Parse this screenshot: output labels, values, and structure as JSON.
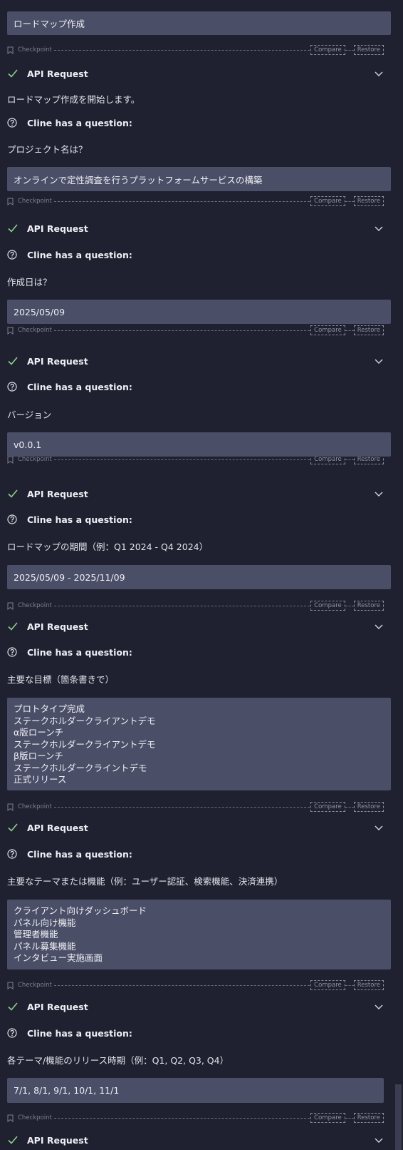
{
  "colors": {
    "background": "#1f2130",
    "message_box": "#4a4e67",
    "text": "#e4e4ec",
    "muted": "#7c7f92",
    "check_green": "#8fd18c"
  },
  "checkpoint": {
    "label": "Checkpoint",
    "compare": "Compare",
    "restore": "Restore",
    "icon": "bookmark-icon"
  },
  "api_request_label": "API Request",
  "question_label": "Cline has a question:",
  "first_message": "ロードマップ作成",
  "intro_text": "ロードマップ作成を開始します。",
  "questions": [
    {
      "text": "プロジェクト名は？",
      "answer": [
        "オンラインで定性調査を行うプラットフォームサービスの構築"
      ]
    },
    {
      "text": "作成日は？",
      "answer": [
        "2025/05/09"
      ]
    },
    {
      "text": "バージョン",
      "answer": [
        "v0.0.1"
      ]
    },
    {
      "text": "ロードマップの期間（例：Q1 2024 - Q4 2024）",
      "answer": [
        "2025/05/09 - 2025/11/09"
      ]
    },
    {
      "text": "主要な目標（箇条書きで）",
      "answer": [
        "プロトタイプ完成",
        "ステークホルダークライアントデモ",
        "α版ローンチ",
        "ステークホルダークライアントデモ",
        "β版ローンチ",
        "ステークホルダークライントデモ",
        "正式リリース"
      ]
    },
    {
      "text": "主要なテーマまたは機能（例：ユーザー認証、検索機能、決済連携）",
      "answer": [
        "クライアント向けダッシュボード",
        "パネル向け機能",
        "管理者機能",
        "パネル募集機能",
        "インタビュー実施画面"
      ]
    },
    {
      "text": "各テーマ/機能のリリース時期（例：Q1, Q2, Q3, Q4）",
      "answer": [
        "7/1, 8/1, 9/1, 10/1, 11/1"
      ]
    }
  ]
}
